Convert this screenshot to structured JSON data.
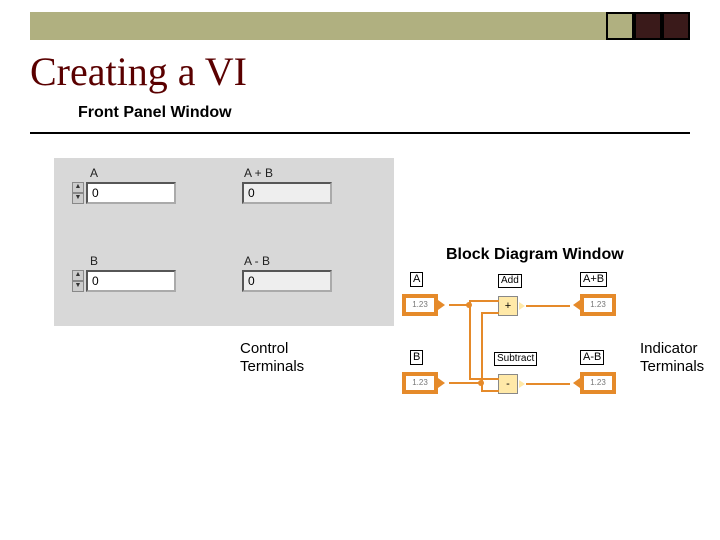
{
  "slide": {
    "title": "Creating a VI",
    "front_panel_label": "Front Panel Window",
    "block_diagram_label": "Block Diagram Window",
    "control_terminals_label": "Control\nTerminals",
    "indicator_terminals_label": "Indicator\nTerminals"
  },
  "front_panel": {
    "controls": {
      "a": {
        "label": "A",
        "value": "0"
      },
      "b": {
        "label": "B",
        "value": "0"
      }
    },
    "indicators": {
      "aplusb": {
        "label": "A + B",
        "value": "0"
      },
      "aminusb": {
        "label": "A - B",
        "value": "0"
      }
    }
  },
  "block_diagram": {
    "terminals": {
      "a": {
        "label": "A",
        "display": "1.23"
      },
      "b": {
        "label": "B",
        "display": "1.23"
      },
      "aplusb": {
        "label": "A+B",
        "display": "1.23"
      },
      "aminusb": {
        "label": "A-B",
        "display": "1.23"
      }
    },
    "nodes": {
      "add": {
        "label": "Add",
        "symbol": "+"
      },
      "subtract": {
        "label": "Subtract",
        "symbol": "-"
      }
    }
  },
  "colors": {
    "wire": "#e58a2a",
    "title": "#5a0000",
    "panel": "#d8d8d8",
    "banner": "#b0b080"
  }
}
